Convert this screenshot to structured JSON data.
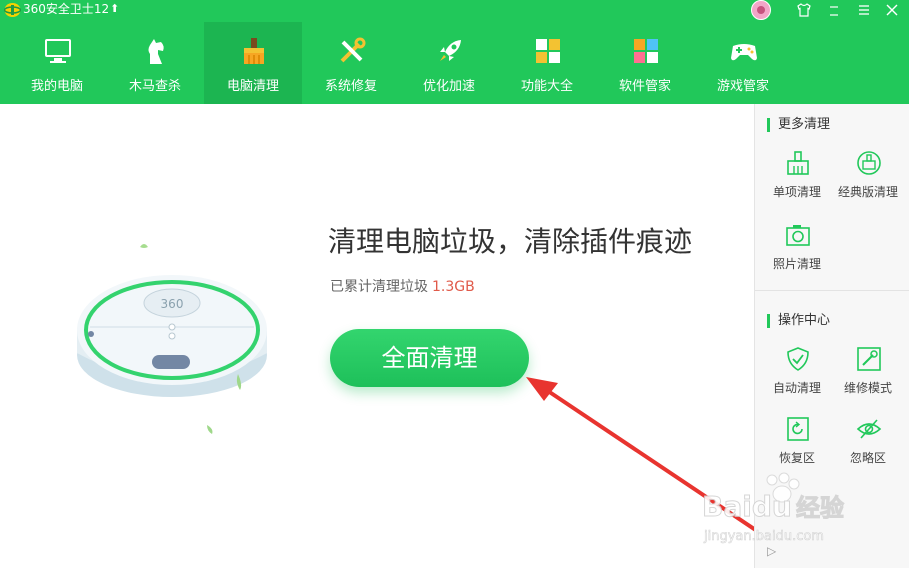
{
  "titlebar": {
    "title": "360安全卫士12",
    "upgrade_icon": "arrow-up-icon"
  },
  "colors": {
    "brand": "#21c85a",
    "brand_dark": "#1cb551",
    "accent_red": "#e05a4a"
  },
  "nav": {
    "items": [
      {
        "label": "我的电脑",
        "icon": "monitor-icon"
      },
      {
        "label": "木马查杀",
        "icon": "trojan-horse-icon"
      },
      {
        "label": "电脑清理",
        "icon": "broom-icon",
        "active": true
      },
      {
        "label": "系统修复",
        "icon": "tools-icon"
      },
      {
        "label": "优化加速",
        "icon": "rocket-icon"
      },
      {
        "label": "功能大全",
        "icon": "grid-icon"
      },
      {
        "label": "软件管家",
        "icon": "software-icon"
      },
      {
        "label": "游戏管家",
        "icon": "gamepad-icon"
      }
    ]
  },
  "main": {
    "headline": "清理电脑垃圾，清除插件痕迹",
    "stats_label": "已累计清理垃圾",
    "stats_value": "1.3GB",
    "primary_button": "全面清理",
    "robot_brand": "360"
  },
  "sidebar": {
    "more_title": "更多清理",
    "more_tools": [
      {
        "label": "单项清理",
        "icon": "brush-icon"
      },
      {
        "label": "经典版清理",
        "icon": "classic-clean-icon"
      },
      {
        "label": "照片清理",
        "icon": "camera-icon"
      }
    ],
    "ops_title": "操作中心",
    "ops_tools": [
      {
        "label": "自动清理",
        "icon": "shield-check-icon"
      },
      {
        "label": "维修模式",
        "icon": "repair-icon"
      },
      {
        "label": "恢复区",
        "icon": "restore-icon"
      },
      {
        "label": "忽略区",
        "icon": "eye-off-icon"
      }
    ],
    "collapse_glyph": "▷"
  },
  "watermark": {
    "brand": "Baidu",
    "brand_cn": "经验",
    "url": "jingyan.baidu.com"
  }
}
